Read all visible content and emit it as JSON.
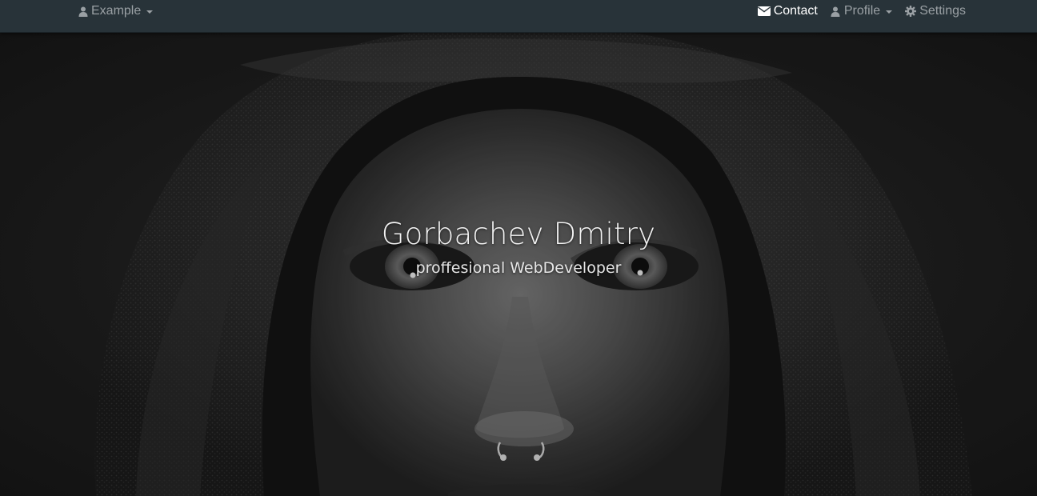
{
  "navbar": {
    "left": {
      "example": {
        "label": "Example",
        "icon": "user-icon",
        "dropdown": true
      }
    },
    "right": {
      "contact": {
        "label": "Contact",
        "icon": "envelope-icon",
        "active": true
      },
      "profile": {
        "label": "Profile",
        "icon": "user-icon",
        "dropdown": true
      },
      "settings": {
        "label": "Settings",
        "icon": "gear-icon"
      }
    },
    "colors": {
      "background": "#283339",
      "text": "#9aa0a4",
      "active_text": "#ffffff"
    }
  },
  "hero": {
    "title": "Gorbachev Dmitry",
    "subtitle": "proffesional WebDeveloper",
    "background_description_icon": "hooded-portrait-image"
  }
}
